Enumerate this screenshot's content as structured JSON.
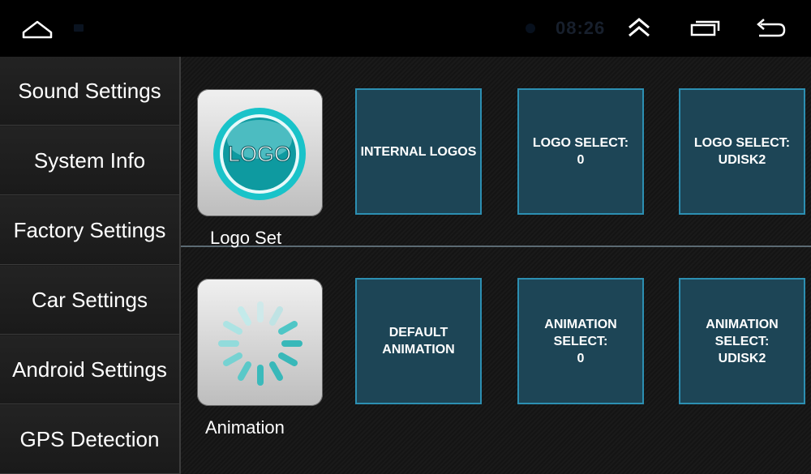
{
  "statusbar": {
    "time": "08:26",
    "icons": [
      "home-icon",
      "camera-icon",
      "chevron-up-icon",
      "recent-apps-icon",
      "back-icon"
    ]
  },
  "sidebar": {
    "items": [
      {
        "label": "Sound Settings"
      },
      {
        "label": "System Info"
      },
      {
        "label": "Factory Settings"
      },
      {
        "label": "Car Settings"
      },
      {
        "label": "Android Settings"
      },
      {
        "label": "GPS Detection"
      }
    ]
  },
  "logo_section": {
    "tile_label": "Logo Set",
    "tile_text": "LOGO",
    "buttons": [
      {
        "label": "INTERNAL LOGOS"
      },
      {
        "label": "LOGO SELECT:\n0"
      },
      {
        "label": "LOGO SELECT:\nUDISK2"
      }
    ]
  },
  "animation_section": {
    "tile_label": "Animation",
    "buttons": [
      {
        "label": "DEFAULT\nANIMATION"
      },
      {
        "label": "ANIMATION\nSELECT:\n0"
      },
      {
        "label": "ANIMATION\nSELECT:\nUDISK2"
      }
    ]
  },
  "colors": {
    "button_fill": "#1d4556",
    "button_border": "#2c8fb2",
    "logo_teal": "#19c3c9",
    "spinner_teal": "#4fc6c6"
  }
}
